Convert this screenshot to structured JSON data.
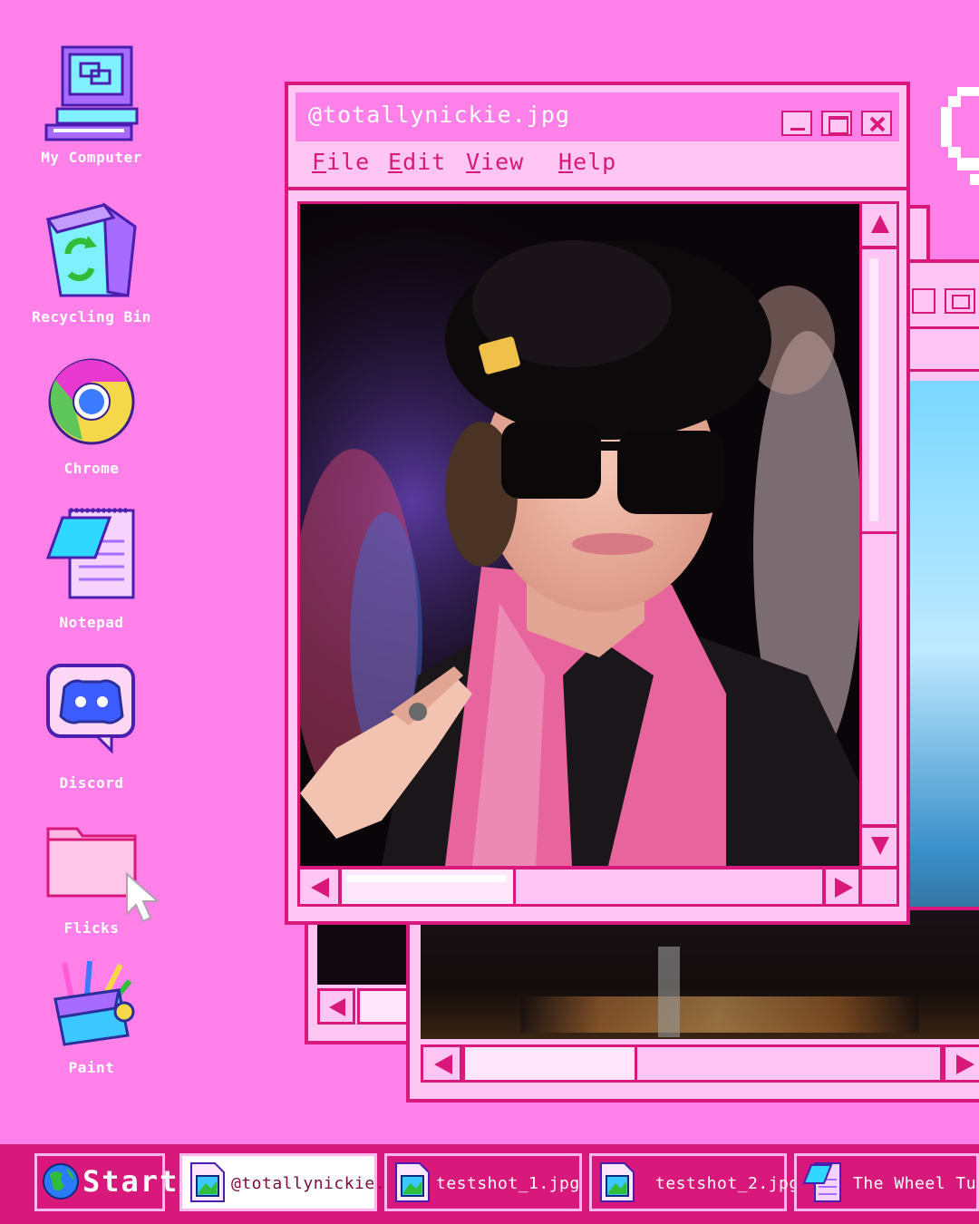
{
  "desktop_icons": [
    {
      "label": "My Computer",
      "icon": "computer-icon"
    },
    {
      "label": "Recycling Bin",
      "icon": "recycle-bin-icon"
    },
    {
      "label": "Chrome",
      "icon": "chrome-icon"
    },
    {
      "label": "Notepad",
      "icon": "notepad-icon"
    },
    {
      "label": "Discord",
      "icon": "discord-icon"
    },
    {
      "label": "Flicks",
      "icon": "folder-icon"
    },
    {
      "label": "Paint",
      "icon": "paint-icon"
    }
  ],
  "main_window": {
    "title": "@totallynickie.jpg",
    "menu": [
      {
        "accel": "F",
        "rest": "ile"
      },
      {
        "accel": "E",
        "rest": "dit"
      },
      {
        "accel": "V",
        "rest": "iew"
      },
      {
        "accel": "H",
        "rest": "elp"
      }
    ],
    "vertical_scroll_position": 0.1,
    "horizontal_scroll_position": 0.0
  },
  "taskbar": {
    "start_label": "Start",
    "items": [
      {
        "label": "@totallynickie.jp",
        "icon": "image-file-icon",
        "active": true
      },
      {
        "label": "testshot_1.jpg",
        "icon": "image-file-icon",
        "active": false
      },
      {
        "label": "testshot_2.jpg",
        "icon": "image-file-icon",
        "active": false
      },
      {
        "label": "The Wheel Tu..",
        "icon": "notepad-icon",
        "active": false
      }
    ]
  },
  "colors": {
    "desktop": "#ff80e8",
    "accent": "#d8187a",
    "window_face": "#ffc6f3",
    "taskbar": "#d8187a"
  }
}
